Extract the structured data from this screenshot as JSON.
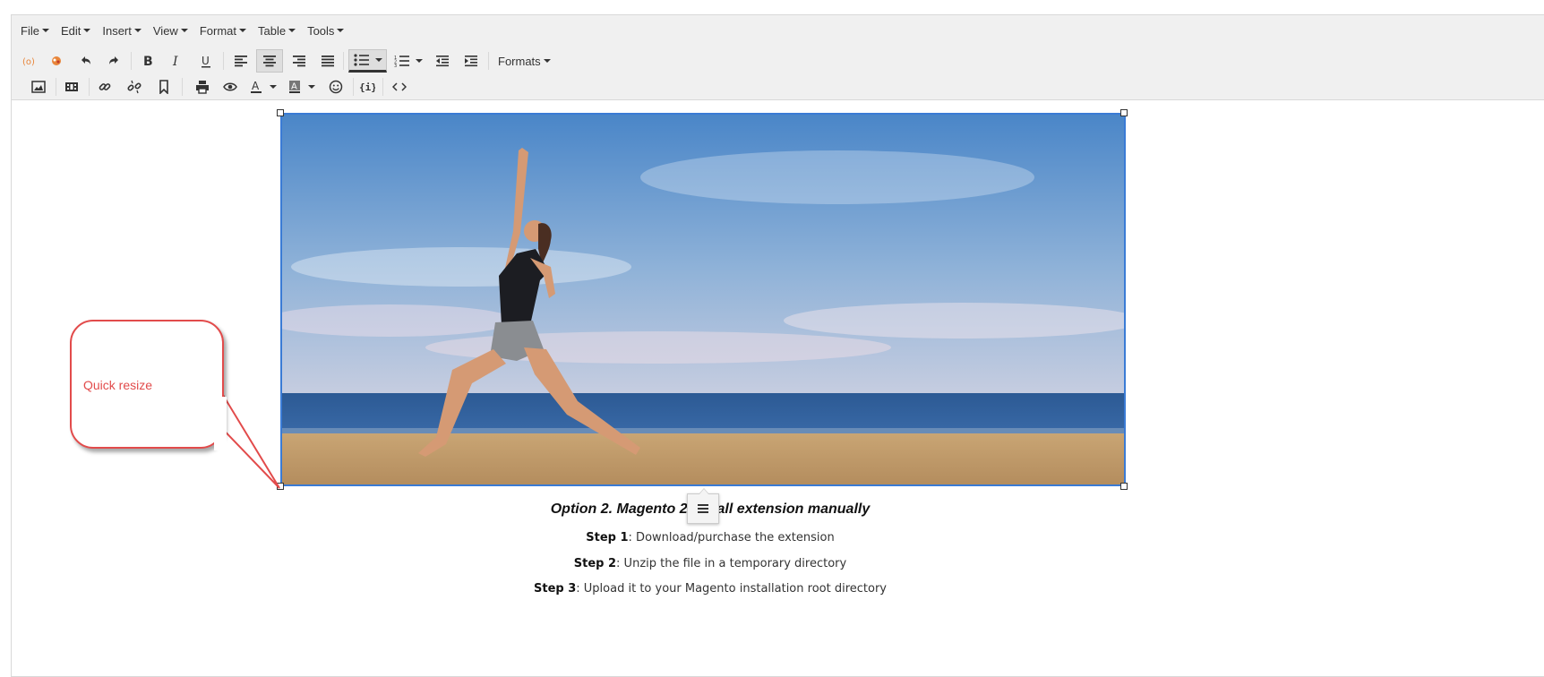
{
  "menubar": {
    "items": [
      {
        "label": "File"
      },
      {
        "label": "Edit"
      },
      {
        "label": "Insert"
      },
      {
        "label": "View"
      },
      {
        "label": "Format"
      },
      {
        "label": "Table"
      },
      {
        "label": "Tools"
      }
    ]
  },
  "toolbar": {
    "formats_label": "Formats",
    "icons_row1": [
      "source-code-icon",
      "image-manager-icon",
      "undo-icon",
      "redo-icon",
      "bold-icon",
      "italic-icon",
      "underline-icon",
      "align-left-icon",
      "align-center-icon",
      "align-right-icon",
      "align-justify-icon",
      "bullet-list-icon",
      "numbered-list-icon",
      "outdent-icon",
      "indent-icon"
    ],
    "icons_row2": [
      "insert-image-icon",
      "insert-media-icon",
      "link-icon",
      "unlink-icon",
      "anchor-icon",
      "print-icon",
      "preview-icon",
      "text-color-icon",
      "background-color-icon",
      "emoticons-icon",
      "template-variable-icon",
      "code-icon"
    ],
    "active": [
      "align-center",
      "bullet-list"
    ]
  },
  "colors": {
    "callout": "#e24b4b",
    "selection": "#3a7bd5",
    "toolbar_bg": "#f0f0f0"
  },
  "annotation": {
    "text": "Quick resize"
  },
  "content": {
    "heading": "Option 2. Magento 2 install extension manually",
    "steps": [
      {
        "label": "Step 1",
        "text": ": Download/purchase the extension"
      },
      {
        "label": "Step 2",
        "text": ": Unzip the file in a temporary directory"
      },
      {
        "label": "Step 3",
        "text": ": Upload it to your Magento installation root directory"
      }
    ]
  }
}
